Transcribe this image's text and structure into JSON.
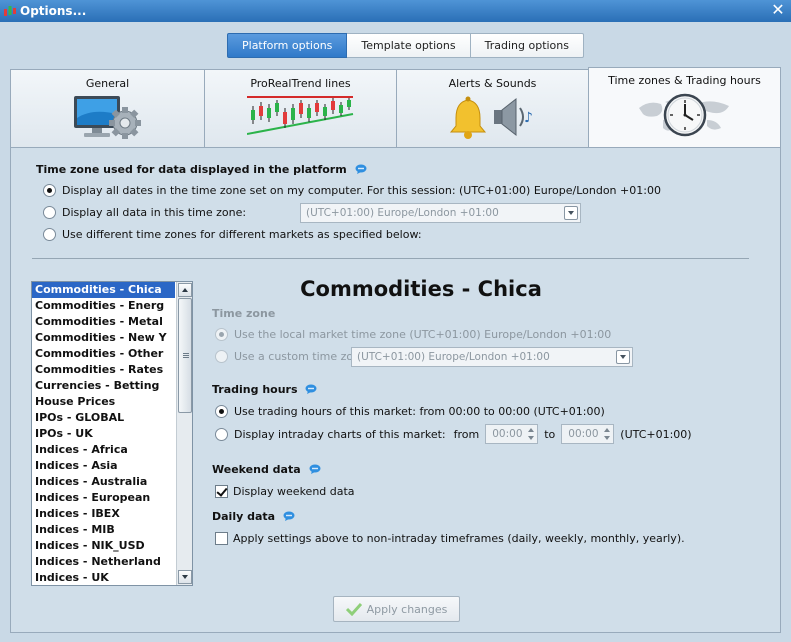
{
  "window": {
    "title": "Options...",
    "close_icon": "close-icon"
  },
  "top_tabs": {
    "platform": "Platform options",
    "template": "Template options",
    "trading": "Trading options"
  },
  "category_tabs": {
    "general": "General",
    "prorealtrend": "ProRealTrend lines",
    "alerts": "Alerts & Sounds",
    "timezones": "Time zones & Trading hours"
  },
  "timezone_section": {
    "title": "Time zone used for data displayed in the platform",
    "option_computer": "Display all dates in the time zone set on my computer. For this session:  (UTC+01:00) Europe/London +01:00",
    "option_specific": "Display all data in this time zone:",
    "specific_value": "(UTC+01:00) Europe/London +01:00",
    "option_per_market": "Use different time zones for different markets as specified below:"
  },
  "markets": {
    "items": [
      "Commodities - Chica",
      "Commodities - Energ",
      "Commodities - Metal",
      "Commodities - New Y",
      "Commodities - Other",
      "Commodities - Rates",
      "Currencies - Betting",
      "House Prices",
      "IPOs - GLOBAL",
      "IPOs - UK",
      "Indices - Africa",
      "Indices - Asia",
      "Indices - Australia",
      "Indices - European",
      "Indices - IBEX",
      "Indices - MIB",
      "Indices - NIK_USD",
      "Indices - Netherland",
      "Indices - UK"
    ],
    "selected_index": 0
  },
  "detail": {
    "market_title": "Commodities - Chica",
    "timezone_label": "Time zone",
    "use_local": "Use the local market time zone (UTC+01:00) Europe/London +01:00",
    "use_custom": "Use a custom time zone:",
    "custom_value": "(UTC+01:00) Europe/London +01:00",
    "trading_hours_label": "Trading hours",
    "use_market_hours": "Use trading hours of this market: from 00:00 to 00:00  (UTC+01:00)",
    "display_intraday": "Display intraday charts of this market:",
    "from_label": "from",
    "from_value": "00:00",
    "to_label": "to",
    "to_value": "00:00",
    "tz_suffix": "(UTC+01:00)",
    "weekend_label": "Weekend data",
    "weekend_checkbox": "Display weekend data",
    "daily_label": "Daily data",
    "daily_checkbox": "Apply settings above to non-intraday timeframes (daily, weekly, monthly, yearly)."
  },
  "footer": {
    "apply": "Apply changes"
  },
  "colors": {
    "accent": "#2f79c9",
    "selection": "#2b67c6",
    "panel": "#d0dee9",
    "titlebar": "#2a6fb6"
  }
}
